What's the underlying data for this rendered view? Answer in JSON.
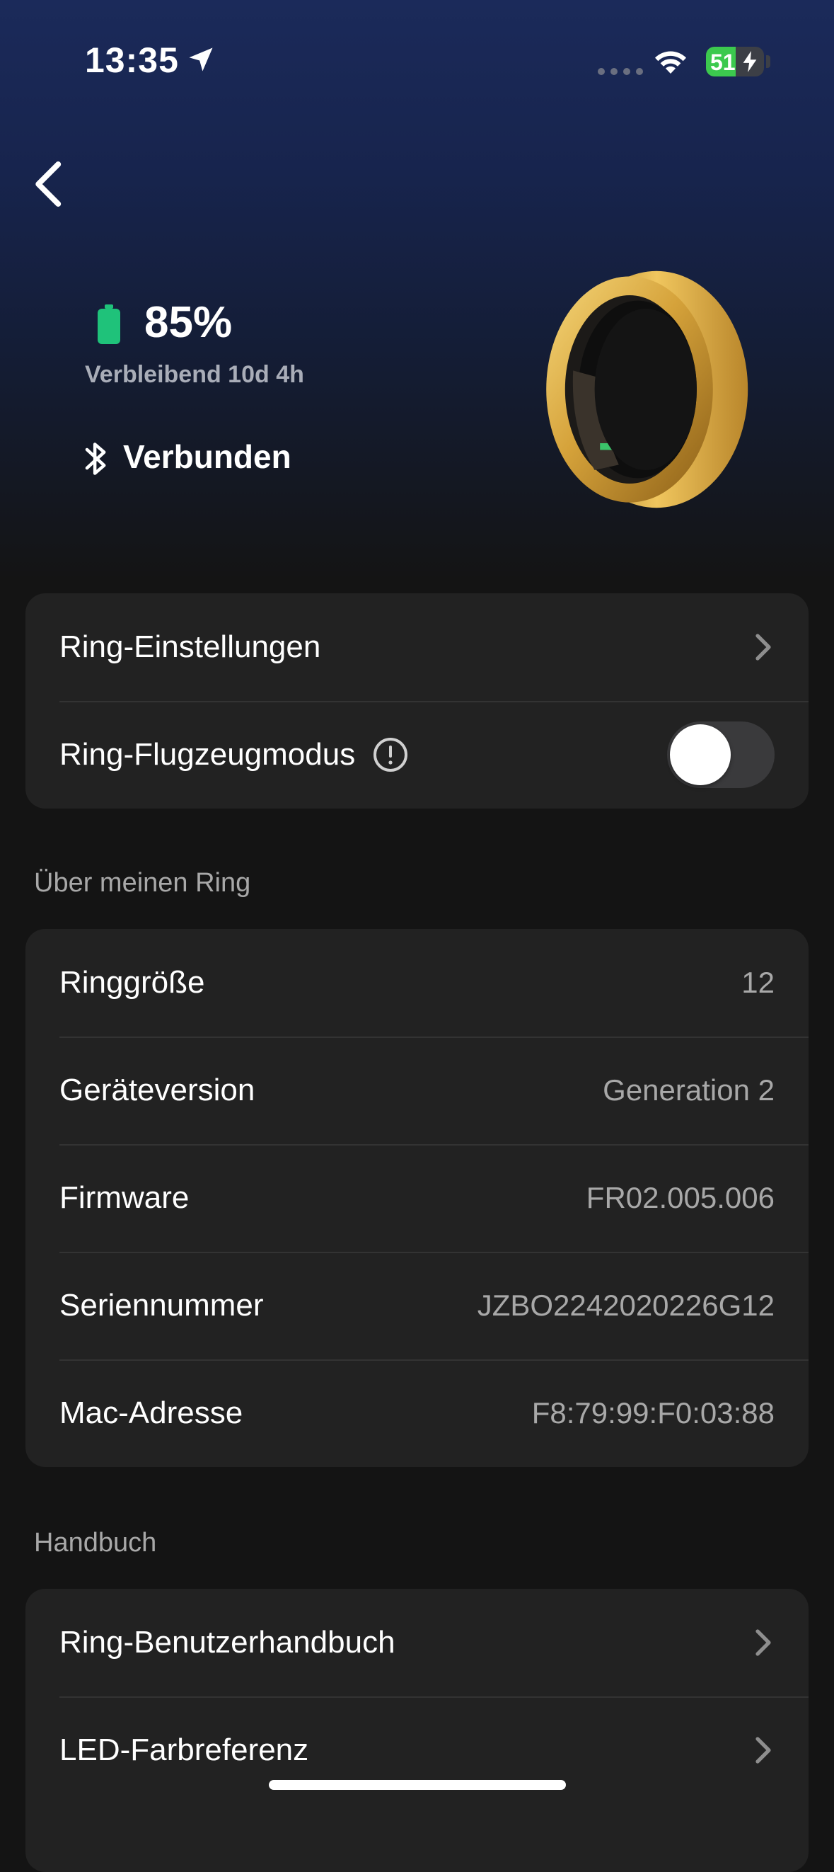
{
  "status_bar": {
    "time": "13:35",
    "battery_level": "51",
    "battery_fraction": 0.51,
    "battery_color": "#3cc94e"
  },
  "hero": {
    "battery_percent": "85%",
    "remaining": "Verbleibend 10d 4h",
    "connection": "Verbunden",
    "battery_icon_color": "#1fc27a",
    "ring_color": "#d9a93a"
  },
  "settings_card": {
    "ring_settings_label": "Ring-Einstellungen",
    "airplane_mode_label": "Ring-Flugzeugmodus",
    "airplane_mode_on": false
  },
  "about": {
    "title": "Über meinen Ring",
    "rows": [
      {
        "label": "Ringgröße",
        "value": "12"
      },
      {
        "label": "Geräteversion",
        "value": "Generation 2"
      },
      {
        "label": "Firmware",
        "value": "FR02.005.006"
      },
      {
        "label": "Seriennummer",
        "value": "JZBO2242020226G12"
      },
      {
        "label": "Mac-Adresse",
        "value": "F8:79:99:F0:03:88"
      }
    ]
  },
  "manual": {
    "title": "Handbuch",
    "items": [
      {
        "label": "Ring-Benutzerhandbuch"
      },
      {
        "label": "LED-Farbreferenz"
      }
    ]
  }
}
